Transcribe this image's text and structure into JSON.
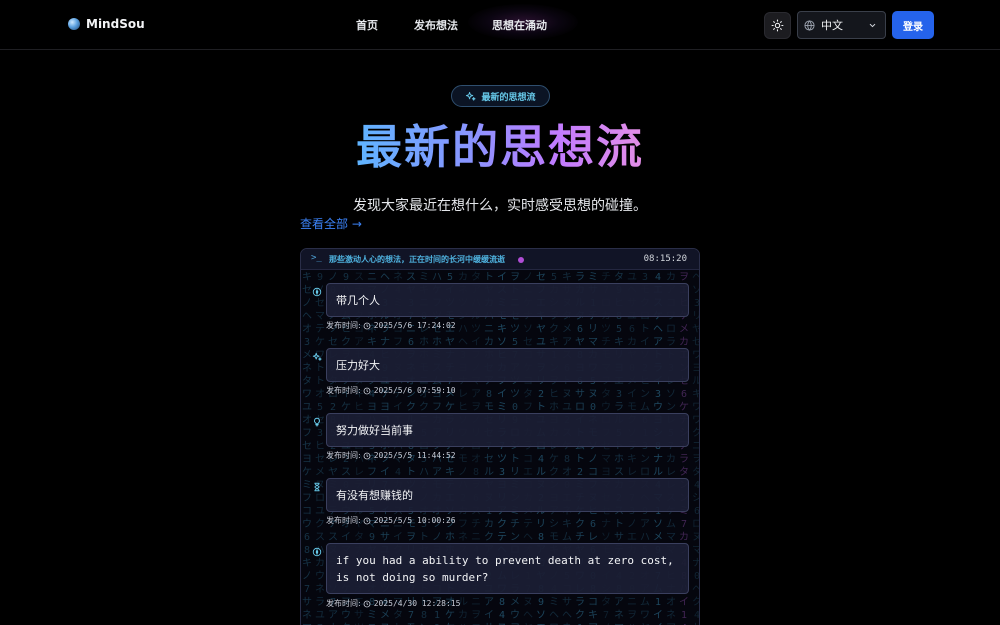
{
  "header": {
    "brand": "MindSou",
    "nav": [
      {
        "label": "首页"
      },
      {
        "label": "发布想法"
      },
      {
        "label": "思想在涌动"
      }
    ],
    "language": "中文",
    "login": "登录",
    "icons": {
      "logo": "brand-orb-icon",
      "theme": "sun-icon",
      "globe": "globe-icon",
      "caret": "chevron-down-icon"
    }
  },
  "hero": {
    "badge": "最新的思想流",
    "title": "最新的思想流",
    "subtitle": "发现大家最近在想什么，实时感受思想的碰撞。",
    "view_all": "查看全部 →"
  },
  "stream": {
    "tagline": "那些激动人心的想法，正在时间的长河中缓缓流逝",
    "clock": "08:15:20",
    "time_label": "发布时间:",
    "entries": [
      {
        "text": "带几个人",
        "time": "2025/5/6 17:24:02",
        "icon": "compass-icon"
      },
      {
        "text": "压力好大",
        "time": "2025/5/6 07:59:10",
        "icon": "sparkles-icon"
      },
      {
        "text": "努力做好当前事",
        "time": "2025/5/5 11:44:52",
        "icon": "lightbulb-icon"
      },
      {
        "text": "有没有想赚钱的",
        "time": "2025/5/5 10:00:26",
        "icon": "hourglass-icon"
      },
      {
        "text": "if you had a ability to prevent death at zero cost, is not doing so murder?",
        "time": "2025/4/30 12:28:15",
        "icon": "compass-icon"
      }
    ]
  },
  "colors": {
    "accent": "#2563eb",
    "gradient_start": "#5fb4ff",
    "gradient_end": "#e48ee6",
    "cyan": "#4fb3e0",
    "live_dot": "#b14dd6"
  }
}
